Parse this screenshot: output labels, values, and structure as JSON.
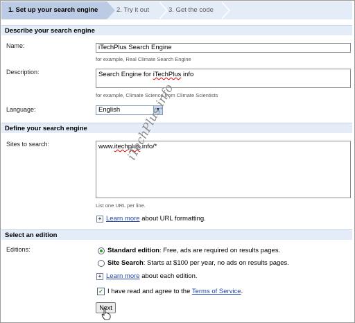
{
  "steps": [
    {
      "label": "1. Set up your search engine"
    },
    {
      "label": "2. Try it out"
    },
    {
      "label": "3. Get the code"
    }
  ],
  "sections": {
    "describe": "Describe your search engine",
    "define": "Define your search engine",
    "edition": "Select an edition"
  },
  "name": {
    "label": "Name:",
    "value": "iTechPlus Search Engine",
    "hint": "for example, Real Climate Search Engine"
  },
  "description": {
    "label": "Description:",
    "value_pre": "Search Engine for ",
    "value_spell": "iTechPlus",
    "value_post": " info",
    "hint": "for example, Climate Science from Climate Scientists"
  },
  "language": {
    "label": "Language:",
    "selected": "English"
  },
  "sites": {
    "label": "Sites to search:",
    "value_a": "www.",
    "value_b": "itechplus",
    "value_c": ".info/*",
    "hint": "List one URL per line.",
    "learn_link": "Learn more",
    "learn_rest": " about URL formatting."
  },
  "editions": {
    "label": "Editions:",
    "standard_title": "Standard edition",
    "standard_desc": ": Free, ads are required on results pages.",
    "site_title": "Site Search",
    "site_desc": ": Starts at $100 per year, no ads on results pages.",
    "learn_link": "Learn more",
    "learn_rest": " about each edition."
  },
  "agree": {
    "pre": "I have read and agree to the ",
    "link": "Terms of Service",
    "post": "."
  },
  "next_button": "Next",
  "watermark": "iTechPlus.info"
}
